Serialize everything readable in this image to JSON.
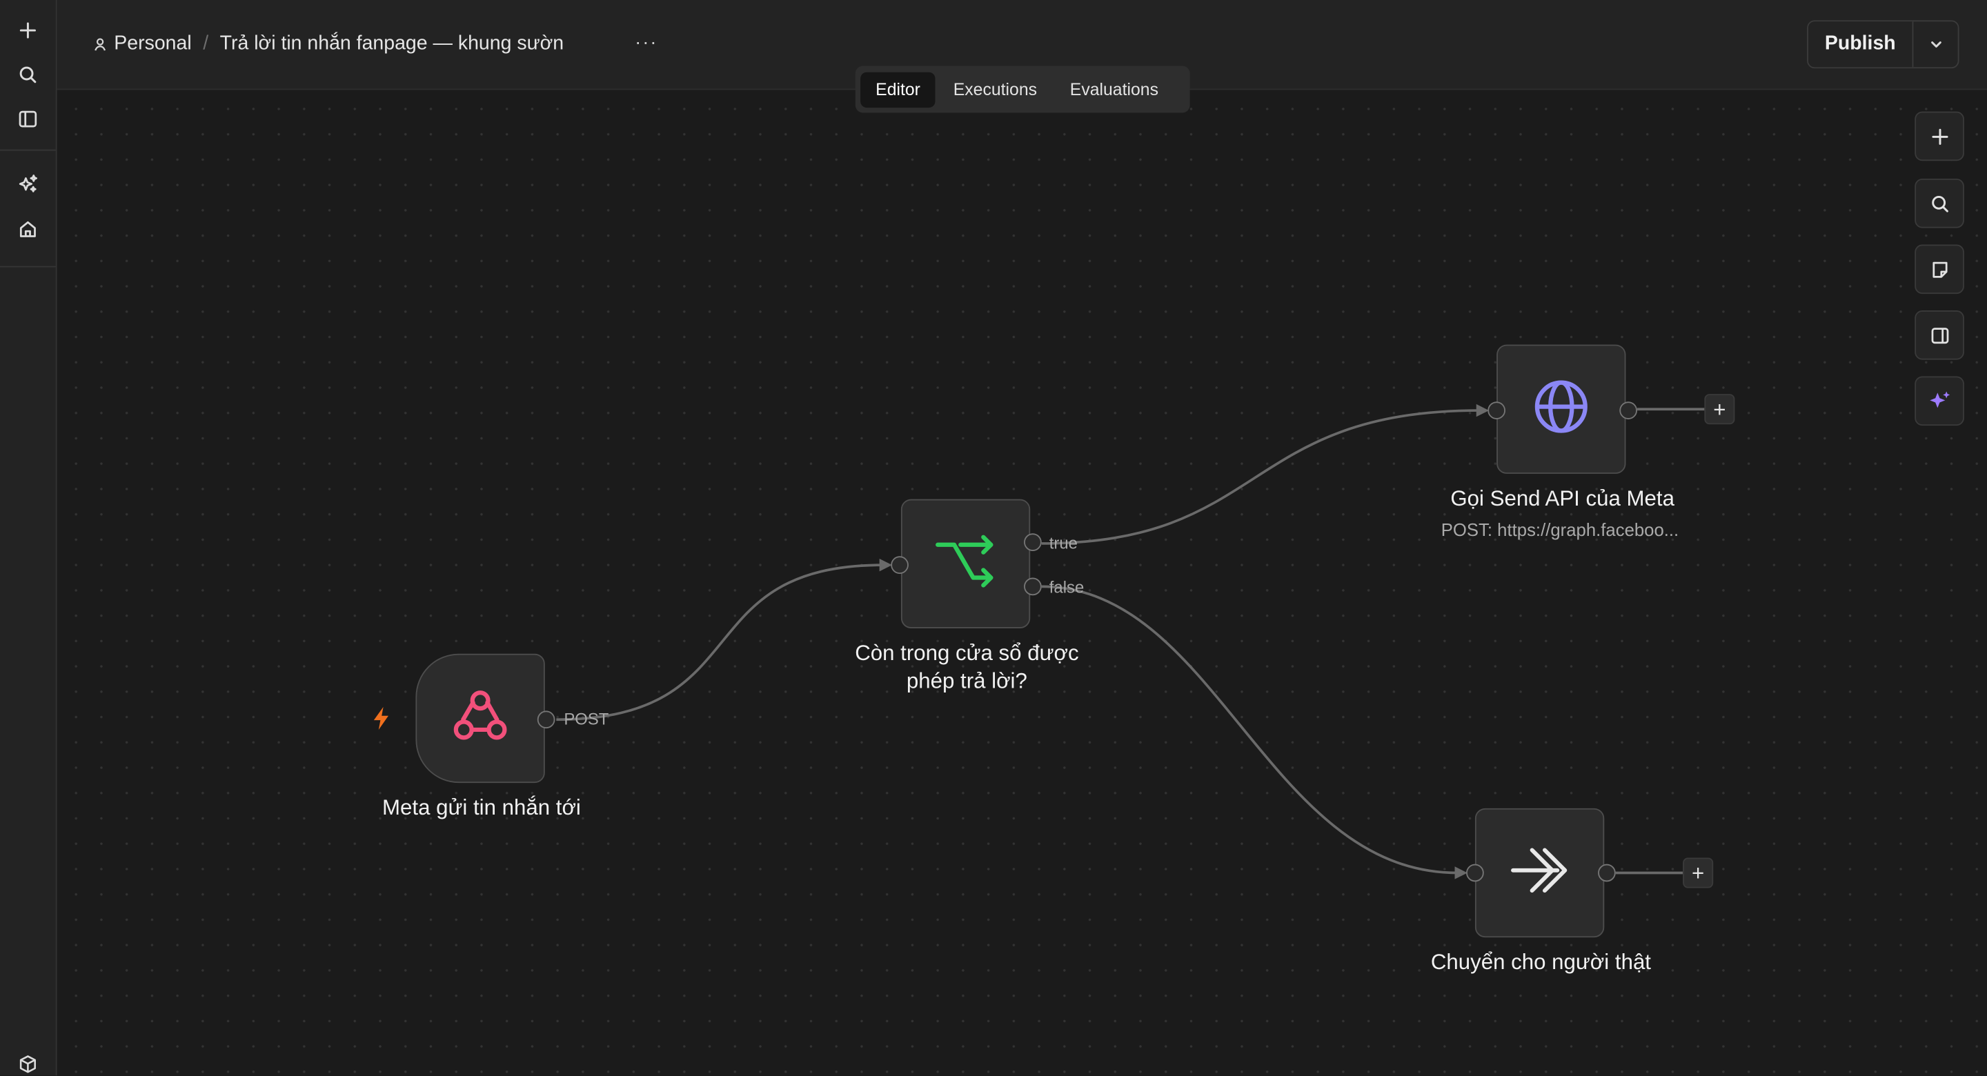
{
  "header": {
    "project": "Personal",
    "workflow_name": "Trả lời tin nhắn fanpage — khung sườn",
    "more_label": "···",
    "publish_label": "Publish"
  },
  "tabs": [
    {
      "label": "Editor",
      "active": true
    },
    {
      "label": "Executions",
      "active": false
    },
    {
      "label": "Evaluations",
      "active": false
    }
  ],
  "sidebar": {
    "icons": [
      "plus-icon",
      "search-icon",
      "panel-icon",
      "sparkles-icon",
      "home-icon",
      "box-icon"
    ]
  },
  "nodes": {
    "webhook": {
      "title": "Meta gửi tin nhắn tới",
      "output_label": "POST",
      "icon": "webhook-icon",
      "icon_color": "#f2507b"
    },
    "if": {
      "title": "Còn trong cửa sổ được phép trả lời?",
      "true_label": "true",
      "false_label": "false",
      "icon": "if-branch-icon",
      "icon_color": "#2ecc59"
    },
    "http": {
      "title": "Gọi Send API của Meta",
      "subtitle": "POST: https://graph.faceboo...",
      "icon": "globe-icon",
      "icon_color": "#8b87f5"
    },
    "noop": {
      "title": "Chuyển cho người thật",
      "icon": "double-arrow-icon",
      "icon_color": "#e8e8e8"
    }
  },
  "trigger_bolt_color": "#f0701e",
  "right_toolbar": [
    "zoom-in-icon",
    "search-icon",
    "sticky-note-icon",
    "panel-toggle-icon",
    "ai-sparkle-icon"
  ],
  "colors": {
    "background": "#1b1b1b",
    "panel": "#232323",
    "edge": "#6a6a6a",
    "ai_accent": "#9d7bff"
  }
}
